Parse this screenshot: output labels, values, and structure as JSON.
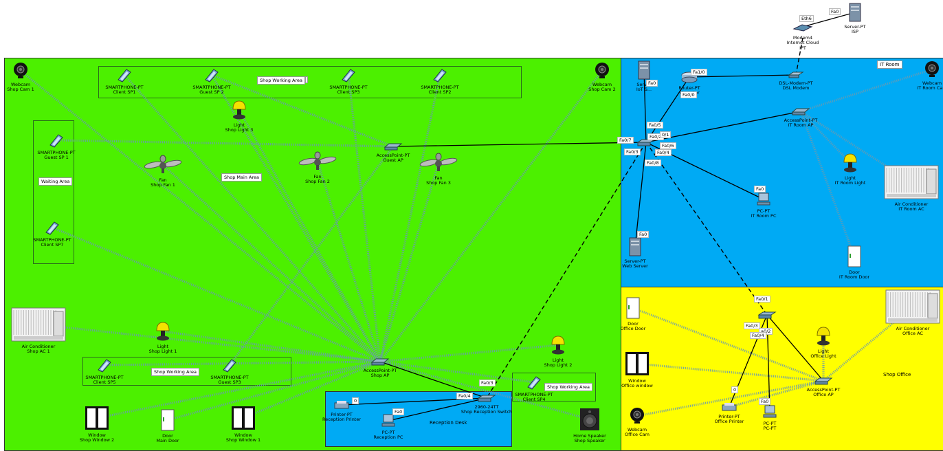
{
  "zones": {
    "shop_main": {
      "color": "#4cf000"
    },
    "it_room": {
      "color": "#00aaf4",
      "label": "IT Room"
    },
    "office": {
      "color": "#ffff00",
      "label": "Shop Office"
    },
    "reception": {
      "color": "#00aaf4",
      "label": "Reception Desk"
    }
  },
  "area_labels": {
    "working_top": "Shop Working Area",
    "main": "Shop Main Area",
    "waiting": "Waiting Area",
    "working_bottom": "Shop Working Area",
    "working_right": "Shop Working Area"
  },
  "devices": [
    {
      "id": "isp",
      "type": "server",
      "l1": "Server-PT",
      "l2": "ISP"
    },
    {
      "id": "modem4",
      "type": "cloud",
      "l1": "Modem4",
      "l2": "Internet Cloud",
      "l3": "IPT"
    },
    {
      "id": "cam1",
      "type": "webcam",
      "l1": "Webcam",
      "l2": "Shop Cam 1"
    },
    {
      "id": "cam2",
      "type": "webcam",
      "l1": "Webcam",
      "l2": "Shop Cam 2"
    },
    {
      "id": "csp1",
      "type": "phone",
      "l1": "SMARTPHONE-PT",
      "l2": "Client SP1"
    },
    {
      "id": "gsp2",
      "type": "phone",
      "l1": "SMARTPHONE-PT",
      "l2": "Guest SP 2"
    },
    {
      "id": "csp3",
      "type": "phone",
      "l1": "SMARTPHONE-PT",
      "l2": "Client SP3"
    },
    {
      "id": "csp2",
      "type": "phone",
      "l1": "SMARTPHONE-PT",
      "l2": "Client SP2"
    },
    {
      "id": "light3",
      "type": "light",
      "l1": "Light",
      "l2": "Shop Light 3"
    },
    {
      "id": "gsp1",
      "type": "phone",
      "l1": "SMARTPHONE-PT",
      "l2": "Guest SP 1"
    },
    {
      "id": "guestap",
      "type": "ap",
      "l1": "AccessPoint-PT",
      "l2": "Guest AP"
    },
    {
      "id": "fan1",
      "type": "fan",
      "l1": "Fan",
      "l2": "Shop Fan 1"
    },
    {
      "id": "fan2",
      "type": "fan",
      "l1": "Fan",
      "l2": "Shop Fan 2"
    },
    {
      "id": "fan3",
      "type": "fan",
      "l1": "Fan",
      "l2": "Shop Fan 3"
    },
    {
      "id": "csp7",
      "type": "phone",
      "l1": "SMARTPHONE-PT",
      "l2": "Client SP7"
    },
    {
      "id": "ac1",
      "type": "ac",
      "l1": "Air Conditioner",
      "l2": "Shop AC 1"
    },
    {
      "id": "light1",
      "type": "light",
      "l1": "Light",
      "l2": "Shop Light 1"
    },
    {
      "id": "csp5",
      "type": "phone",
      "l1": "SMARTPHONE-PT",
      "l2": "Client SP5"
    },
    {
      "id": "gsp3",
      "type": "phone",
      "l1": "SMARTPHONE-PT",
      "l2": "Guest SP3"
    },
    {
      "id": "shopap",
      "type": "ap",
      "l1": "AccessPoint-PT",
      "l2": "Shop AP"
    },
    {
      "id": "light2",
      "type": "light",
      "l1": "Light",
      "l2": "Shop Light 2"
    },
    {
      "id": "csp4",
      "type": "phone",
      "l1": "SMARTPHONE-PT",
      "l2": "Client SP4"
    },
    {
      "id": "win2",
      "type": "window",
      "l1": "Window",
      "l2": "Shop Window 2"
    },
    {
      "id": "maindoor",
      "type": "door",
      "l1": "Door",
      "l2": "Main Door"
    },
    {
      "id": "win1",
      "type": "window",
      "l1": "Window",
      "l2": "Shop Window 1"
    },
    {
      "id": "printer_r",
      "type": "printer",
      "l1": "Printer-PT",
      "l2": "Reception Printer"
    },
    {
      "id": "pc_r",
      "type": "pc",
      "l1": "PC-PT",
      "l2": "Reception PC"
    },
    {
      "id": "sw_r",
      "type": "switch",
      "l1": "2960-24TT",
      "l2": "Shop Reception Switch"
    },
    {
      "id": "speaker",
      "type": "speaker",
      "l1": "Home Speaker",
      "l2": "Shop Speaker"
    },
    {
      "id": "iotserver",
      "type": "server",
      "l1": "Server",
      "l2": "IoT S..."
    },
    {
      "id": "router",
      "type": "router",
      "l1": "Router-PT",
      "l2": "M... ...ter"
    },
    {
      "id": "dslmodem",
      "type": "modem",
      "l1": "DSL-Modem-PT",
      "l2": "DSL Modem"
    },
    {
      "id": "itcam",
      "type": "webcam",
      "l1": "Webcam",
      "l2": "IT Room Cam"
    },
    {
      "id": "itap",
      "type": "ap",
      "l1": "AccessPoint-PT",
      "l2": "IT Room AP"
    },
    {
      "id": "mainsw",
      "type": "switch",
      "l1": "",
      "l2": ""
    },
    {
      "id": "itlight",
      "type": "light",
      "l1": "Light",
      "l2": "IT Room Light"
    },
    {
      "id": "itpc",
      "type": "pc",
      "l1": "PC-PT",
      "l2": "IT Room PC"
    },
    {
      "id": "itac",
      "type": "ac",
      "l1": "Air Conditioner",
      "l2": "IT Room AC"
    },
    {
      "id": "webserver",
      "type": "server",
      "l1": "Server-PT",
      "l2": "Web Server"
    },
    {
      "id": "itdoor",
      "type": "door",
      "l1": "Door",
      "l2": "IT Room Door"
    },
    {
      "id": "officedoor",
      "type": "door",
      "l1": "Door",
      "l2": "Office Door"
    },
    {
      "id": "officesw",
      "type": "switch",
      "l1": "",
      "l2": ""
    },
    {
      "id": "officeac",
      "type": "ac",
      "l1": "Air Conditioner",
      "l2": "Office AC"
    },
    {
      "id": "officelight",
      "type": "light",
      "l1": "Light",
      "l2": "Office Light"
    },
    {
      "id": "officewin",
      "type": "window",
      "l1": "Window",
      "l2": "Office window"
    },
    {
      "id": "officeap",
      "type": "ap",
      "l1": "AccessPoint-PT",
      "l2": "Office AP"
    },
    {
      "id": "officeprinter",
      "type": "printer",
      "l1": "Printer-PT",
      "l2": "Office Printer"
    },
    {
      "id": "officepc",
      "type": "pc",
      "l1": "PC-PT",
      "l2": "PC-PT"
    },
    {
      "id": "officecam",
      "type": "webcam",
      "l1": "Webcam",
      "l2": "Office Cam"
    }
  ],
  "ports": {
    "isp_fa0": "Fa0",
    "modem_eth6": "Eth6",
    "guest_fa07": "Fa0/7",
    "iot_fa0": "Fa0",
    "router_fa10": "Fa1/0",
    "router_fa00": "Fa0/0",
    "sw_fa05": "Fa0/5",
    "sw_fa02": "Fa0/2",
    "sw_01": "0/1",
    "sw_fa03": "Fa0/3",
    "sw_fa06": "Fa0/6",
    "sw_fa04": "Fa0/4",
    "sw_fa08": "Fa0/8",
    "itpc_fa0": "Fa0",
    "web_fa0": "Fa0",
    "osw_fa01": "Fa0/1",
    "osw_fa03": "Fa0/3",
    "osw_02": "a0/2",
    "osw_fa04": "Fa0/4",
    "oprinter_0": "0",
    "opc_fa0": "Fa0",
    "rsw_fa03": "Fa0/3",
    "rsw_fa04": "Fa0/4",
    "rprinter_0": "0",
    "rpc_fa0": "Fa0",
    "mainsw_partial": "...T"
  },
  "colors": {
    "wire": "#000000",
    "wireless": "#6b9ab0",
    "green": "#4cf000",
    "blue": "#00aaf4",
    "yellow": "#ffff00"
  }
}
